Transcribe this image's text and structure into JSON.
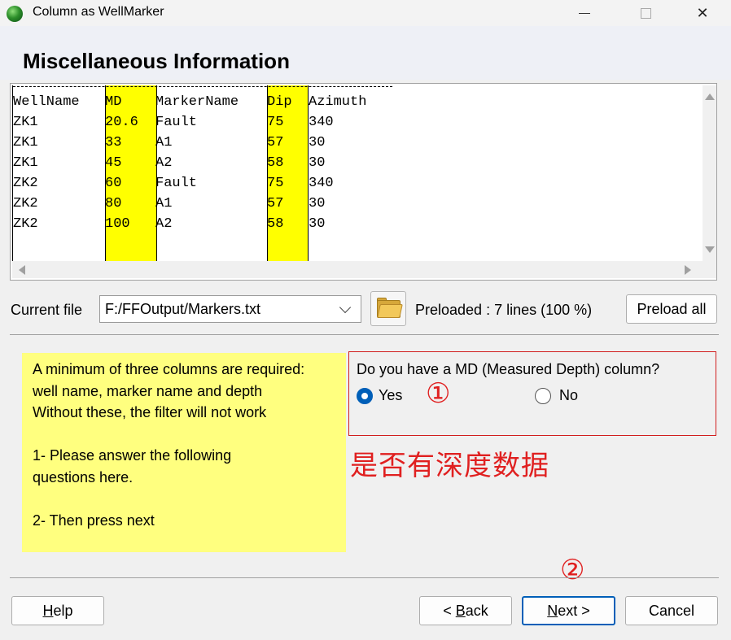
{
  "window": {
    "title": "Column as WellMarker",
    "controls": {
      "minimize": "—",
      "maximize": "☐",
      "close": "✕"
    }
  },
  "header": {
    "title": "Miscellaneous Information"
  },
  "preview": {
    "columns": [
      "WellName",
      "MD",
      "MarkerName",
      "Dip",
      "Azimuth"
    ],
    "highlighted_columns": [
      "MD",
      "Dip"
    ],
    "highlight_color": "#ffff00",
    "rows": [
      [
        "ZK1",
        "20.6",
        "Fault",
        "75",
        "340"
      ],
      [
        "ZK1",
        "33",
        "A1",
        "57",
        "30"
      ],
      [
        "ZK1",
        "45",
        "A2",
        "58",
        "30"
      ],
      [
        "ZK2",
        "60",
        "Fault",
        "75",
        "340"
      ],
      [
        "ZK2",
        "80",
        "A1",
        "57",
        "30"
      ],
      [
        "ZK2",
        "100",
        "A2",
        "58",
        "30"
      ]
    ]
  },
  "file": {
    "label": "Current file",
    "value": "F:/FFOutput/Markers.txt",
    "folder_icon": "folder-icon",
    "preloaded_text": "Preloaded : 7 lines (100 %)",
    "preload_all_label": "Preload all"
  },
  "info": {
    "background": "#ffff7f",
    "lines": [
      "A minimum of three columns are required:",
      "well name, marker name and depth",
      "Without these, the filter will not work",
      "1- Please answer the following",
      "questions here.",
      "2- Then press next"
    ]
  },
  "question": {
    "text": "Do you have a MD (Measured Depth) column?",
    "yes_label": "Yes",
    "no_label": "No",
    "selected": "Yes"
  },
  "annotations": {
    "color": "#e02020",
    "marker_1": "①",
    "marker_2": "②",
    "note": "是否有深度数据"
  },
  "buttons": {
    "help": {
      "mnemonic": "H",
      "rest": "elp"
    },
    "back": {
      "prefix": "< ",
      "mnemonic": "B",
      "rest": "ack"
    },
    "next": {
      "mnemonic": "N",
      "rest": "ext >"
    },
    "cancel": "Cancel"
  }
}
